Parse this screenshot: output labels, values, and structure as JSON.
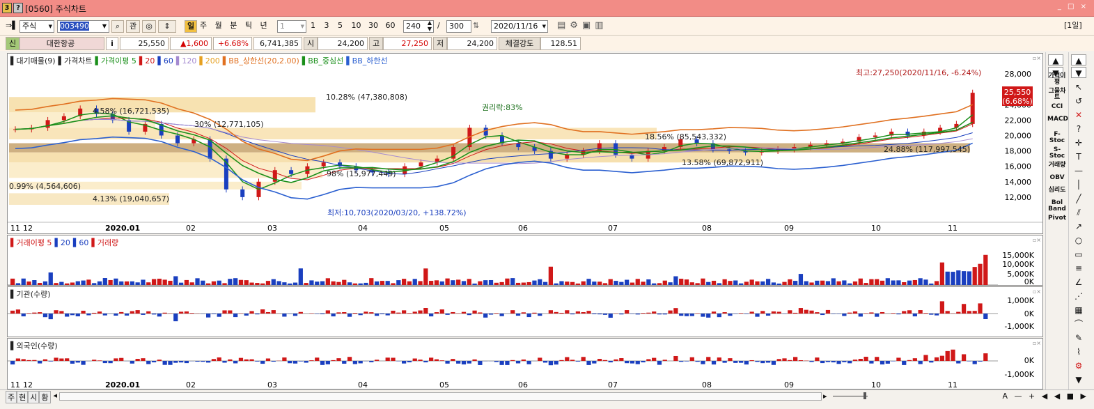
{
  "window": {
    "badge_num": "3",
    "badge_q": "?",
    "title": "[0560] 주식차트",
    "controls": "_ □ ×"
  },
  "toolbar": {
    "market": "주식",
    "code": "003490",
    "search_icon": "magnifier-icon",
    "rel_label": "관",
    "period_selected": "일",
    "periods": [
      "주",
      "월",
      "분",
      "틱",
      "년"
    ],
    "interval_value": "1",
    "intervals": [
      "1",
      "3",
      "5",
      "10",
      "30",
      "60"
    ],
    "count_value": "240",
    "slash": "/",
    "max_count": "300",
    "date": "2020/11/16",
    "right_label": "[1일]"
  },
  "quote": {
    "badge": "신",
    "name": "대한항공",
    "info": "i",
    "price": "25,550",
    "change": "▲1,600",
    "change_pct": "+6.68%",
    "volume": "6,741,385",
    "open_label": "시",
    "open": "24,200",
    "high_label": "고",
    "high": "27,250",
    "low_label": "저",
    "low": "24,200",
    "strength_label": "체결강도",
    "strength": "128.51"
  },
  "price_panel": {
    "legend": [
      {
        "text": "▌대기매물(9)",
        "color": "#222222"
      },
      {
        "text": "▌가격차트",
        "color": "#222222"
      },
      {
        "text": "▌가격이평 5",
        "color": "#1a8f1a"
      },
      {
        "text": "▌20",
        "color": "#d01818"
      },
      {
        "text": "▌60",
        "color": "#1a3fbf"
      },
      {
        "text": "▌120",
        "color": "#a48ad0"
      },
      {
        "text": "▌200",
        "color": "#e6a020"
      },
      {
        "text": "▌BB_상한선(20,2.00)",
        "color": "#e07020"
      },
      {
        "text": "▌BB_중심선",
        "color": "#1a8f1a"
      },
      {
        "text": "▌BB_하한선",
        "color": "#2a5fd0"
      }
    ],
    "y_ticks": [
      "28,000",
      "26,000",
      "24,000",
      "22,000",
      "20,000",
      "18,000",
      "16,000",
      "14,000",
      "12,000"
    ],
    "x_ticks": [
      "11",
      "12",
      "2020.01",
      "02",
      "03",
      "04",
      "05",
      "06",
      "07",
      "08",
      "09",
      "10",
      "11"
    ],
    "annotations": {
      "high": "최고:27,250(2020/11/16, -6.24%)",
      "low": "최저:10,703(2020/03/20, +138.72%)",
      "rights": "권리락:83%"
    },
    "current_price": "25,550",
    "current_pct": "(6.68%)",
    "supply_labels": [
      "10.28% (47,380,808)",
      "4.58% (16,721,535)",
      "30% (12,771,105)",
      "98% (15,977,449)",
      "18.56% (85,543,332)",
      "13.58% (69,872,911)",
      "24.88% (117,997,545)",
      "0.99% (4,564,606)",
      "4.13% (19,040,657)"
    ]
  },
  "volume_panel": {
    "legend": [
      {
        "text": "▌거래이평 5",
        "color": "#d01818"
      },
      {
        "text": "▌20",
        "color": "#1a3fbf"
      },
      {
        "text": "▌60",
        "color": "#1a3fbf"
      },
      {
        "text": "▌거래량",
        "color": "#d01818"
      }
    ],
    "y_ticks": [
      "15,000K",
      "10,000K",
      "5,000K",
      "0K"
    ]
  },
  "inst_panel": {
    "legend": [
      {
        "text": "▌기관(수량)",
        "color": "#222222"
      }
    ],
    "y_ticks": [
      "1,000K",
      "0K",
      "-1,000K"
    ]
  },
  "foreign_panel": {
    "legend": [
      {
        "text": "▌외국인(수량)",
        "color": "#222222"
      }
    ],
    "y_ticks": [
      "0K",
      "-1,000K"
    ],
    "x_ticks": [
      "11",
      "12",
      "2020.01",
      "02",
      "03",
      "04",
      "05",
      "06",
      "07",
      "08",
      "09",
      "10",
      "11"
    ]
  },
  "side_menu": [
    "가격이평",
    "그물차트",
    "CCI",
    "MACD",
    "F-Stoc",
    "S-Stoc",
    "거래량",
    "OBV",
    "심리도",
    "Bol Band",
    "Pivot"
  ],
  "bottom": {
    "tabs": [
      "주",
      "현",
      "시",
      "황"
    ],
    "controls": "A — + ◀ ◀ ■ ▶"
  },
  "chart_data": {
    "type": "candlestick",
    "months": [
      "11",
      "12",
      "2020.01",
      "02",
      "03",
      "04",
      "05",
      "06",
      "07",
      "08",
      "09",
      "10",
      "11"
    ],
    "close": [
      20800,
      21000,
      22000,
      22500,
      23500,
      22800,
      22000,
      20500,
      21500,
      20000,
      19000,
      19500,
      17000,
      13000,
      12000,
      14000,
      15500,
      15000,
      16000,
      16500,
      16000,
      15500,
      15200,
      15000,
      16000,
      16500,
      17000,
      18500,
      21000,
      20000,
      19000,
      18500,
      18000,
      17000,
      17500,
      18000,
      19000,
      17500,
      17000,
      18000,
      18500,
      19500,
      19000,
      18200,
      18000,
      17800,
      18000,
      18200,
      18500,
      18800,
      19000,
      19200,
      19800,
      20000,
      20500,
      20000,
      20500,
      21000,
      21500,
      25550
    ],
    "ylim": [
      10000,
      29000
    ],
    "high_point": {
      "value": 27250,
      "date": "2020/11/16"
    },
    "low_point": {
      "value": 10703,
      "date": "2020/03/20"
    }
  }
}
